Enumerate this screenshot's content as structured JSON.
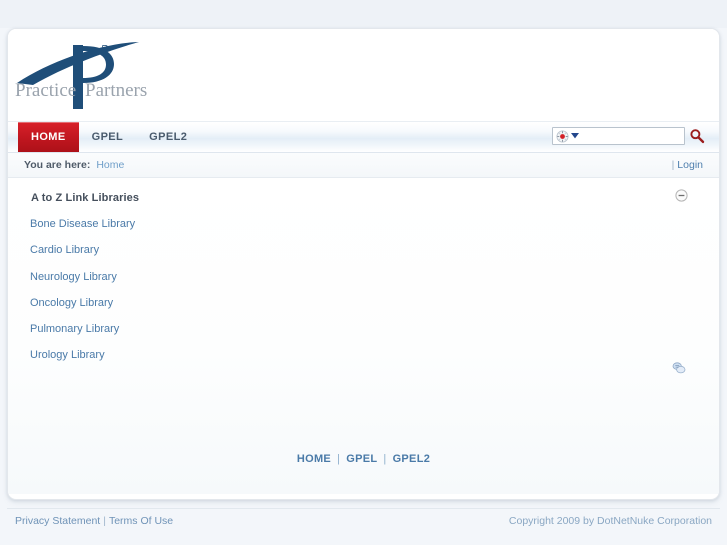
{
  "brand": {
    "name_left": "Practice",
    "name_right": "Partners",
    "superscript": "2",
    "logo_icon": "practice-partners-p2-logo",
    "mark_color": "#1f4e79",
    "text_color": "#9aa3ad"
  },
  "nav": {
    "items": [
      {
        "label": "HOME",
        "active": true
      },
      {
        "label": "GPEL",
        "active": false
      },
      {
        "label": "GPEL2",
        "active": false
      }
    ]
  },
  "search": {
    "value": "",
    "placeholder": "",
    "selector_icon": "search-provider-icon",
    "dropdown_icon": "chevron-down-icon",
    "submit_icon": "search-magnifier-icon"
  },
  "breadcrumb": {
    "prefix": "You are here:",
    "current": "Home",
    "divider": "|",
    "login_label": "Login"
  },
  "module": {
    "title": "A to Z Link Libraries",
    "collapse_icon": "collapse-minus-icon",
    "action_icon": "module-actions-icon",
    "links": [
      {
        "label": "Bone Disease Library"
      },
      {
        "label": "Cardio Library"
      },
      {
        "label": "Neurology Library"
      },
      {
        "label": "Oncology Library"
      },
      {
        "label": "Pulmonary Library"
      },
      {
        "label": "Urology Library"
      }
    ]
  },
  "footer_nav": {
    "items": [
      {
        "label": "HOME"
      },
      {
        "label": "GPEL"
      },
      {
        "label": "GPEL2"
      }
    ],
    "separator": "|"
  },
  "copyright": {
    "privacy_label": "Privacy Statement",
    "separator": "|",
    "terms_label": "Terms Of Use",
    "notice": "Copyright 2009 by DotNetNuke Corporation"
  },
  "colors": {
    "accent_red": "#c0161f",
    "link_blue": "#4a7aa8",
    "page_bg": "#eef2f7"
  }
}
